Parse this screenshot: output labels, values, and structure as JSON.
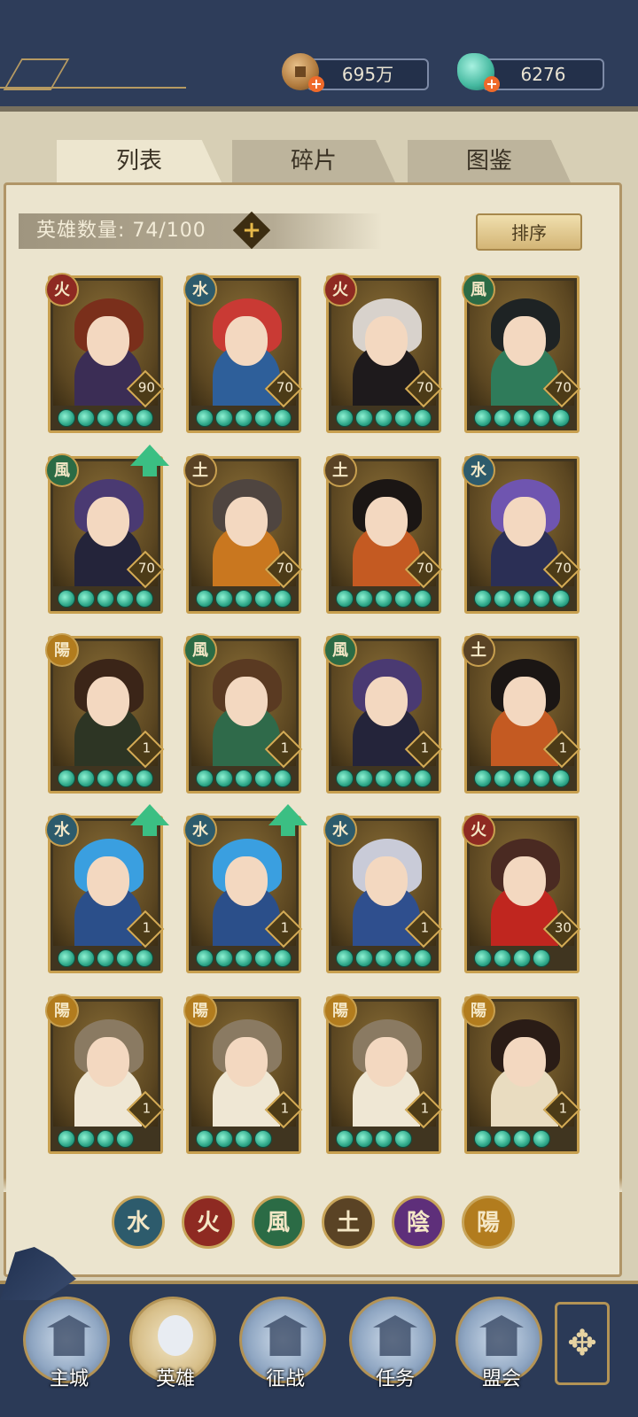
{
  "header": {
    "gold": {
      "value": "695万",
      "icon": "copper-coin-icon"
    },
    "jade": {
      "value": "6276",
      "icon": "jade-icon"
    }
  },
  "tabs": [
    {
      "label": "列表",
      "active": true
    },
    {
      "label": "碎片",
      "active": false
    },
    {
      "label": "图鉴",
      "active": false
    }
  ],
  "hero_count": {
    "label": "英雄数量: 74/100"
  },
  "sort_label": "排序",
  "heroes": [
    {
      "element": "火",
      "level": "90",
      "stars": 5,
      "can_upgrade": false,
      "hair": "#7a2f1b",
      "outfit": "#3b2d55"
    },
    {
      "element": "水",
      "level": "70",
      "stars": 5,
      "can_upgrade": false,
      "hair": "#c93a34",
      "outfit": "#2e5f9a"
    },
    {
      "element": "火",
      "level": "70",
      "stars": 5,
      "can_upgrade": false,
      "hair": "#d8d2cc",
      "outfit": "#1e1a1c"
    },
    {
      "element": "風",
      "level": "70",
      "stars": 5,
      "can_upgrade": false,
      "hair": "#1e2324",
      "outfit": "#2f7b5a"
    },
    {
      "element": "風",
      "level": "70",
      "stars": 5,
      "can_upgrade": true,
      "hair": "#4a3a72",
      "outfit": "#24243a"
    },
    {
      "element": "土",
      "level": "70",
      "stars": 5,
      "can_upgrade": false,
      "hair": "#4f4540",
      "outfit": "#c9771f"
    },
    {
      "element": "土",
      "level": "70",
      "stars": 5,
      "can_upgrade": false,
      "hair": "#1b1614",
      "outfit": "#c45a22"
    },
    {
      "element": "水",
      "level": "70",
      "stars": 5,
      "can_upgrade": false,
      "hair": "#6f55b0",
      "outfit": "#2b2f55"
    },
    {
      "element": "陽",
      "level": "1",
      "stars": 5,
      "can_upgrade": false,
      "hair": "#3b2518",
      "outfit": "#2d3524"
    },
    {
      "element": "風",
      "level": "1",
      "stars": 5,
      "can_upgrade": false,
      "hair": "#5a3a22",
      "outfit": "#2f6a4a"
    },
    {
      "element": "風",
      "level": "1",
      "stars": 5,
      "can_upgrade": false,
      "hair": "#4a3a72",
      "outfit": "#24243a"
    },
    {
      "element": "土",
      "level": "1",
      "stars": 5,
      "can_upgrade": false,
      "hair": "#1b1614",
      "outfit": "#c45a22"
    },
    {
      "element": "水",
      "level": "1",
      "stars": 5,
      "can_upgrade": true,
      "hair": "#3a9fe0",
      "outfit": "#2b4f8a"
    },
    {
      "element": "水",
      "level": "1",
      "stars": 5,
      "can_upgrade": true,
      "hair": "#3a9fe0",
      "outfit": "#2b4f8a"
    },
    {
      "element": "水",
      "level": "1",
      "stars": 5,
      "can_upgrade": false,
      "hair": "#c9cbd8",
      "outfit": "#2f4f8e"
    },
    {
      "element": "火",
      "level": "30",
      "stars": 4,
      "can_upgrade": false,
      "hair": "#4a2a22",
      "outfit": "#c0261f"
    },
    {
      "element": "陽",
      "level": "1",
      "stars": 4,
      "can_upgrade": false,
      "hair": "#8a7a62",
      "outfit": "#efe7d4"
    },
    {
      "element": "陽",
      "level": "1",
      "stars": 4,
      "can_upgrade": false,
      "hair": "#8a7a62",
      "outfit": "#efe7d4"
    },
    {
      "element": "陽",
      "level": "1",
      "stars": 4,
      "can_upgrade": false,
      "hair": "#8a7a62",
      "outfit": "#efe7d4"
    },
    {
      "element": "陽",
      "level": "1",
      "stars": 4,
      "can_upgrade": false,
      "hair": "#2a1c16",
      "outfit": "#e9dcc0"
    }
  ],
  "element_filters": [
    {
      "label": "水",
      "color": "#2d5b6c"
    },
    {
      "label": "火",
      "color": "#8e2a22"
    },
    {
      "label": "風",
      "color": "#2b6b45"
    },
    {
      "label": "土",
      "color": "#5a4325"
    },
    {
      "label": "陰",
      "color": "#5e2f7a"
    },
    {
      "label": "陽",
      "color": "#b27c1e"
    }
  ],
  "nav": [
    {
      "label": "主城",
      "active": false
    },
    {
      "label": "英雄",
      "active": true
    },
    {
      "label": "征战",
      "active": false
    },
    {
      "label": "任务",
      "active": false
    },
    {
      "label": "盟会",
      "active": false
    }
  ],
  "menu_icon": "lattice-menu-icon"
}
